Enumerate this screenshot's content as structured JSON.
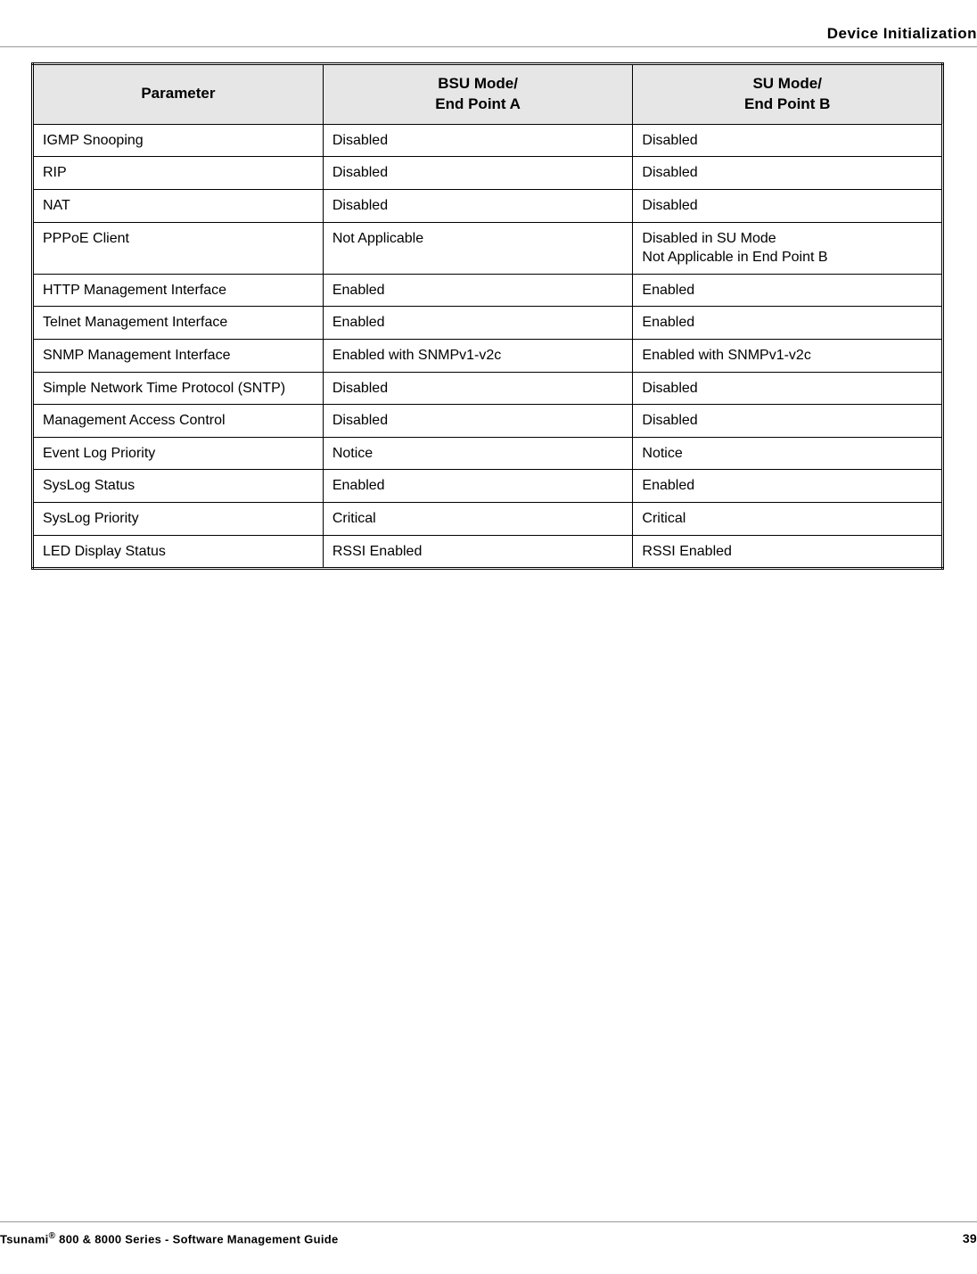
{
  "header": {
    "section_title": "Device Initialization"
  },
  "table": {
    "columns": [
      {
        "line1": "Parameter",
        "line2": ""
      },
      {
        "line1": "BSU Mode/",
        "line2": "End Point A"
      },
      {
        "line1": "SU Mode/",
        "line2": "End Point B"
      }
    ],
    "rows": [
      {
        "param": "IGMP Snooping",
        "bsu": "Disabled",
        "su": "Disabled"
      },
      {
        "param": "RIP",
        "bsu": "Disabled",
        "su": "Disabled"
      },
      {
        "param": "NAT",
        "bsu": "Disabled",
        "su": "Disabled"
      },
      {
        "param": "PPPoE Client",
        "bsu": "Not Applicable",
        "su": "Disabled in SU Mode\nNot Applicable in End Point B"
      },
      {
        "param": "HTTP Management Interface",
        "bsu": "Enabled",
        "su": "Enabled"
      },
      {
        "param": "Telnet Management Interface",
        "bsu": "Enabled",
        "su": "Enabled"
      },
      {
        "param": "SNMP Management Interface",
        "bsu": "Enabled with SNMPv1-v2c",
        "su": "Enabled with SNMPv1-v2c"
      },
      {
        "param": "Simple Network Time Protocol (SNTP)",
        "bsu": "Disabled",
        "su": "Disabled"
      },
      {
        "param": "Management Access Control",
        "bsu": "Disabled",
        "su": "Disabled"
      },
      {
        "param": "Event Log Priority",
        "bsu": "Notice",
        "su": "Notice"
      },
      {
        "param": "SysLog Status",
        "bsu": "Enabled",
        "su": "Enabled"
      },
      {
        "param": "SysLog Priority",
        "bsu": "Critical",
        "su": "Critical"
      },
      {
        "param": "LED Display Status",
        "bsu": "RSSI Enabled",
        "su": "RSSI Enabled"
      }
    ]
  },
  "footer": {
    "product_prefix": "Tsunami",
    "reg_mark": "®",
    "product_suffix": " 800 & 8000 Series - Software Management Guide",
    "page_number": "39"
  }
}
